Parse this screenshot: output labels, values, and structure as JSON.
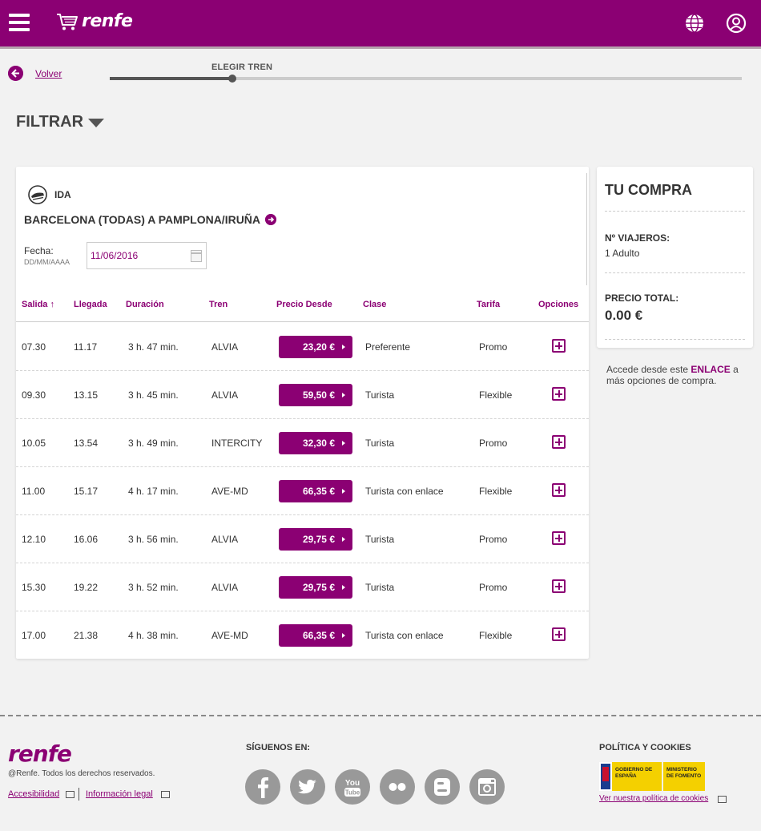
{
  "header": {
    "brand": "renfe",
    "menu_icon": "hamburger-menu-icon",
    "cart_icon": "cart-icon",
    "globe_icon": "globe-icon",
    "user_icon": "user-icon",
    "color": "#8b0073"
  },
  "nav": {
    "back_label": "Volver",
    "step_label": "ELEGIR TREN"
  },
  "filter": {
    "label": "FILTRAR"
  },
  "journey": {
    "direction": "IDA",
    "route": "BARCELONA (TODAS) A PAMPLONA/IRUÑA",
    "date_label": "Fecha:",
    "date_format": "DD/MM/AAAA",
    "date_value": "11/06/2016"
  },
  "table": {
    "headers": {
      "salida": "Salida",
      "llegada": "Llegada",
      "duracion": "Duración",
      "tren": "Tren",
      "precio": "Precio Desde",
      "clase": "Clase",
      "tarifa": "Tarifa",
      "opciones": "Opciones"
    },
    "sort_indicator": "↑",
    "rows": [
      {
        "salida": "07.30",
        "llegada": "11.17",
        "duracion": "3 h. 47 min.",
        "tren": "ALVIA",
        "precio": "23,20 €",
        "clase": "Preferente",
        "tarifa": "Promo"
      },
      {
        "salida": "09.30",
        "llegada": "13.15",
        "duracion": "3 h. 45 min.",
        "tren": "ALVIA",
        "precio": "59,50 €",
        "clase": "Turista",
        "tarifa": "Flexible"
      },
      {
        "salida": "10.05",
        "llegada": "13.54",
        "duracion": "3 h. 49 min.",
        "tren": "INTERCITY",
        "precio": "32,30 €",
        "clase": "Turista",
        "tarifa": "Promo"
      },
      {
        "salida": "11.00",
        "llegada": "15.17",
        "duracion": "4 h. 17 min.",
        "tren": "AVE-MD",
        "precio": "66,35 €",
        "clase": "Turista con enlace",
        "tarifa": "Flexible"
      },
      {
        "salida": "12.10",
        "llegada": "16.06",
        "duracion": "3 h. 56 min.",
        "tren": "ALVIA",
        "precio": "29,75 €",
        "clase": "Turista",
        "tarifa": "Promo"
      },
      {
        "salida": "15.30",
        "llegada": "19.22",
        "duracion": "3 h. 52 min.",
        "tren": "ALVIA",
        "precio": "29,75 €",
        "clase": "Turista",
        "tarifa": "Promo"
      },
      {
        "salida": "17.00",
        "llegada": "21.38",
        "duracion": "4 h. 38 min.",
        "tren": "AVE-MD",
        "precio": "66,35 €",
        "clase": "Turista con enlace",
        "tarifa": "Flexible"
      }
    ]
  },
  "purchase": {
    "title": "TU COMPRA",
    "travelers_label": "Nº VIAJEROS:",
    "travelers_value": "1 Adulto",
    "total_label": "PRECIO TOTAL:",
    "total_value": "0.00 €"
  },
  "enlace_note": {
    "before": "Accede desde este ",
    "link": "ENLACE",
    "after": " a más opciones de compra."
  },
  "footer": {
    "brand": "renfe",
    "copyright": "@Renfe. Todos los derechos reservados.",
    "accessibility_link": "Accesibilidad",
    "legal_link": "Información legal",
    "social_heading": "SÍGUENOS EN:",
    "social_icons": [
      "facebook-icon",
      "twitter-icon",
      "youtube-icon",
      "flickr-icon",
      "blogger-icon",
      "instagram-icon"
    ],
    "policy_heading": "POLÍTICA Y COOKIES",
    "gov_text_1": "GOBIERNO DE ESPAÑA",
    "gov_text_2": "MINISTERIO DE FOMENTO",
    "policy_link": "Ver nuestra política de cookies"
  }
}
